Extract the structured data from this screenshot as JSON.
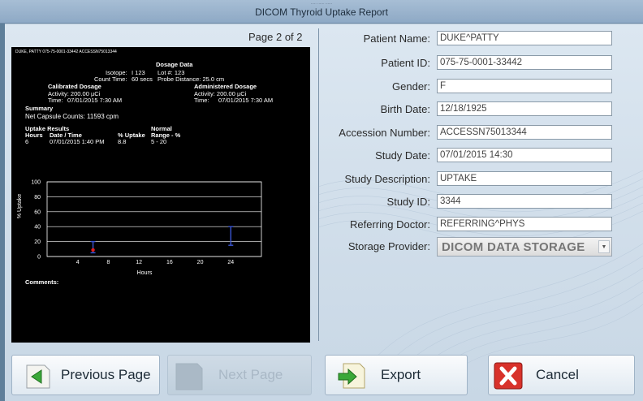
{
  "window": {
    "title": "DICOM Thyroid Uptake Report",
    "subtitle": "..... ...... ......"
  },
  "report": {
    "page_label": "Page 2 of 2",
    "header_line": "DUKE, PATTY 075-75-0001-33442 ACCESSN75013344",
    "dosage_heading": "Dosage Data",
    "isotope_label": "Isotope:",
    "isotope_value": "I 123",
    "lot_label": "Lot #: 123",
    "count_time_label": "Count Time:",
    "count_time_value": "60 secs",
    "probe_distance": "Probe Distance: 25.0 cm",
    "calibrated_heading": "Calibrated Dosage",
    "calibrated_activity": "Activity: 200.00 µCi",
    "calibrated_time": "Time:",
    "calibrated_time_value": "07/01/2015 7:30 AM",
    "administered_heading": "Administered Dosage",
    "administered_activity": "Activity: 200.00 µCi",
    "administered_time": "Time:",
    "administered_time_value": "07/01/2015 7:30 AM",
    "summary_heading": "Summary",
    "net_counts": "Net Capsule Counts: 11593 cpm",
    "uptake_heading": "Uptake Results",
    "normal_heading": "Normal",
    "col_hours": "Hours",
    "col_datetime": "Date / Time",
    "col_uptake": "% Uptake",
    "col_range": "Range - %",
    "row": {
      "hours": "6",
      "datetime": "07/01/2015 1:40 PM",
      "uptake": "8.8",
      "range": "5 - 20"
    },
    "comments_label": "Comments:"
  },
  "chart_data": {
    "type": "scatter",
    "xlabel": "Hours",
    "ylabel": "% Uptake",
    "xlim": [
      0,
      28
    ],
    "ylim": [
      0,
      100
    ],
    "x_ticks": [
      4,
      8,
      12,
      16,
      20,
      24
    ],
    "y_ticks": [
      0,
      20,
      40,
      60,
      80,
      100
    ],
    "measured": [
      {
        "x": 6,
        "y": 8.8
      }
    ],
    "normal_ranges": [
      {
        "x": 6,
        "low": 5,
        "high": 20
      },
      {
        "x": 24,
        "low": 15,
        "high": 40
      }
    ],
    "colors": {
      "measured": "#e01c1c",
      "range": "#3a55d4"
    }
  },
  "form": {
    "patient_name": {
      "label": "Patient Name:",
      "value": "DUKE^PATTY"
    },
    "patient_id": {
      "label": "Patient ID:",
      "value": "075-75-0001-33442"
    },
    "gender": {
      "label": "Gender:",
      "value": "F"
    },
    "birth_date": {
      "label": "Birth Date:",
      "value": "12/18/1925"
    },
    "accession": {
      "label": "Accession Number:",
      "value": "ACCESSN75013344"
    },
    "study_date": {
      "label": "Study Date:",
      "value": "07/01/2015 14:30"
    },
    "study_description": {
      "label": "Study Description:",
      "value": "UPTAKE"
    },
    "study_id": {
      "label": "Study ID:",
      "value": "3344"
    },
    "referring_doctor": {
      "label": "Referring Doctor:",
      "value": "REFERRING^PHYS"
    },
    "storage_provider": {
      "label": "Storage Provider:",
      "value": "DICOM DATA STORAGE"
    }
  },
  "buttons": {
    "previous": "Previous Page",
    "next": "Next Page",
    "export": "Export",
    "cancel": "Cancel"
  }
}
